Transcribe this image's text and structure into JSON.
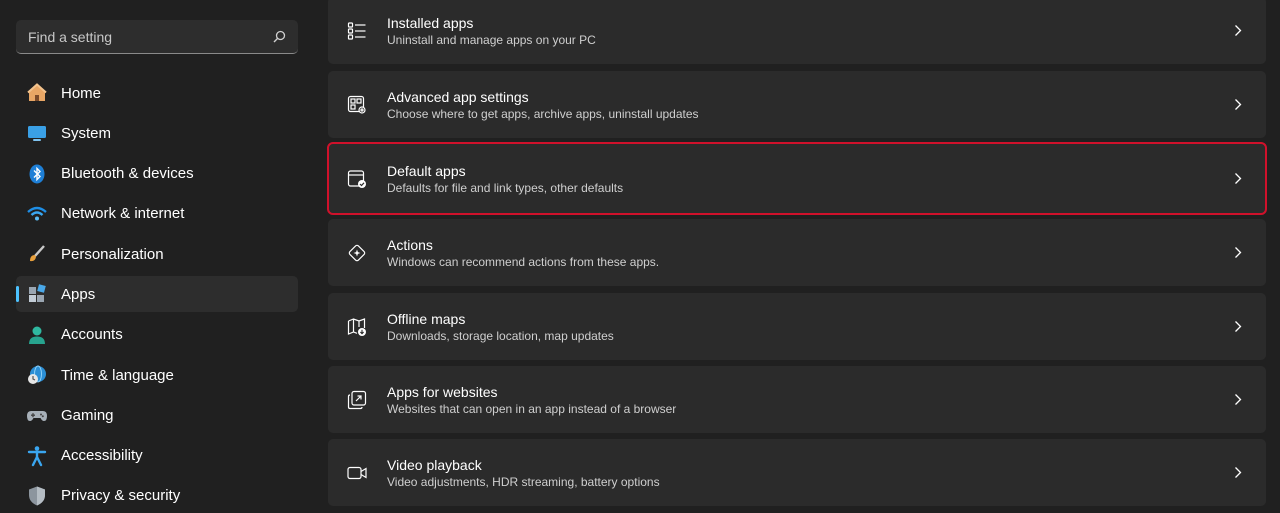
{
  "search": {
    "placeholder": "Find a setting",
    "icon": "search-icon"
  },
  "sidebar": {
    "items": [
      {
        "label": "Home",
        "icon": "home-icon"
      },
      {
        "label": "System",
        "icon": "system-icon"
      },
      {
        "label": "Bluetooth & devices",
        "icon": "bluetooth-icon"
      },
      {
        "label": "Network & internet",
        "icon": "wifi-icon"
      },
      {
        "label": "Personalization",
        "icon": "brush-icon"
      },
      {
        "label": "Apps",
        "icon": "apps-icon",
        "active": true
      },
      {
        "label": "Accounts",
        "icon": "account-icon"
      },
      {
        "label": "Time & language",
        "icon": "globe-clock-icon"
      },
      {
        "label": "Gaming",
        "icon": "controller-icon"
      },
      {
        "label": "Accessibility",
        "icon": "accessibility-icon"
      },
      {
        "label": "Privacy & security",
        "icon": "shield-icon"
      }
    ]
  },
  "cards": [
    {
      "title": "Installed apps",
      "subtitle": "Uninstall and manage apps on your PC",
      "icon": "list-icon"
    },
    {
      "title": "Advanced app settings",
      "subtitle": "Choose where to get apps, archive apps, uninstall updates",
      "icon": "app-settings-icon"
    },
    {
      "title": "Default apps",
      "subtitle": "Defaults for file and link types, other defaults",
      "icon": "default-apps-icon",
      "highlighted": true
    },
    {
      "title": "Actions",
      "subtitle": "Windows can recommend actions from these apps.",
      "icon": "actions-icon"
    },
    {
      "title": "Offline maps",
      "subtitle": "Downloads, storage location, map updates",
      "icon": "map-icon"
    },
    {
      "title": "Apps for websites",
      "subtitle": "Websites that can open in an app instead of a browser",
      "icon": "open-in-app-icon"
    },
    {
      "title": "Video playback",
      "subtitle": "Video adjustments, HDR streaming, battery options",
      "icon": "video-icon"
    }
  ],
  "colors": {
    "accent": "#4cc2ff",
    "highlight_border": "#d0112b",
    "card_bg": "#2b2b2b",
    "window_bg": "#202020"
  }
}
